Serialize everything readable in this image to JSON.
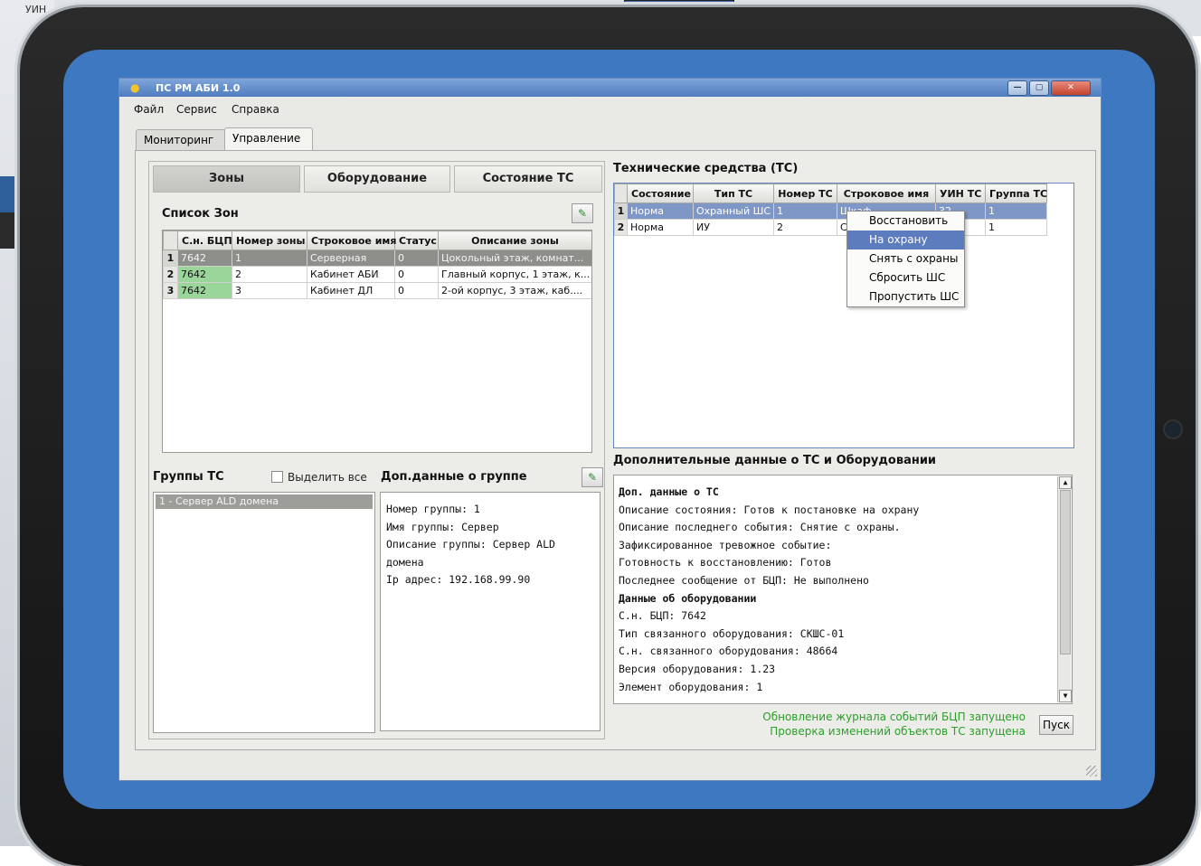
{
  "background": {
    "top_text": "УИН"
  },
  "window": {
    "title": "ПС РМ АБИ 1.0",
    "controls": [
      "—",
      "▢",
      "✕"
    ]
  },
  "menu": [
    "Файл",
    "Сервис",
    "Справка"
  ],
  "tabs": [
    "Мониторинг",
    "Управление"
  ],
  "segments": [
    "Зоны",
    "Оборудование",
    "Состояние ТС"
  ],
  "zones": {
    "title": "Список Зон",
    "columns": [
      "С.н. БЦП",
      "Номер зоны",
      "Строковое имя",
      "Статус",
      "Описание зоны"
    ],
    "rows": [
      {
        "n": "1",
        "cells": [
          "7642",
          "1",
          "Серверная",
          "0",
          "Цокольный этаж, комнат..."
        ]
      },
      {
        "n": "2",
        "cells": [
          "7642",
          "2",
          "Кабинет АБИ",
          "0",
          "Главный корпус, 1 этаж, к..."
        ]
      },
      {
        "n": "3",
        "cells": [
          "7642",
          "3",
          "Кабинет ДЛ",
          "0",
          "2-ой корпус, 3 этаж, каб...."
        ]
      }
    ]
  },
  "groups": {
    "title": "Группы ТС",
    "select_all": "Выделить все",
    "items": [
      "1 - Сервер ALD домена"
    ],
    "details_title": "Доп.данные о группе",
    "details": [
      "Номер группы: 1",
      "Имя группы: Сервер",
      "Описание группы: Сервер ALD",
      "домена",
      "Ip адрес: 192.168.99.90"
    ]
  },
  "ts": {
    "title": "Технические средства (ТС)",
    "columns": [
      "Состояние",
      "Тип ТС",
      "Номер ТС",
      "Строковое имя",
      "УИН ТС",
      "Группа ТС"
    ],
    "rows": [
      {
        "n": "1",
        "cells": [
          "Норма",
          "Охранный ШС",
          "1",
          "Шкаф",
          "32",
          "1"
        ]
      },
      {
        "n": "2",
        "cells": [
          "Норма",
          "ИУ",
          "2",
          "С",
          "",
          "1"
        ]
      }
    ]
  },
  "context_menu": [
    "Восстановить",
    "На охрану",
    "Снять с охраны",
    "Сбросить ШС",
    "Пропустить ШС"
  ],
  "extra": {
    "title": "Дополнительные данные о ТС и Оборудовании",
    "lines": [
      "Доп. данные о ТС",
      "Описание состояния: Готов к постановке на охрану",
      "Описание последнего события: Снятие с охраны.",
      "Зафиксированное тревожное событие:",
      "Готовность к восстановлению: Готов",
      "Последнее сообщение от БЦП: Не выполнено",
      "Данные об оборудовании",
      "С.н. БЦП: 7642",
      "Тип связанного оборудования: СКШС-01",
      "С.н. связанного оборудования: 48664",
      "Версия оборудования: 1.23",
      "Элемент оборудования: 1"
    ]
  },
  "status": [
    "Обновление журнала событий БЦП запущено",
    "Проверка изменений объектов ТС запущена"
  ],
  "start_button": "Пуск",
  "colors": {
    "accent": "#4f7cc0",
    "status_ok": "#2aa02a",
    "desktop": "#3e78c0"
  }
}
